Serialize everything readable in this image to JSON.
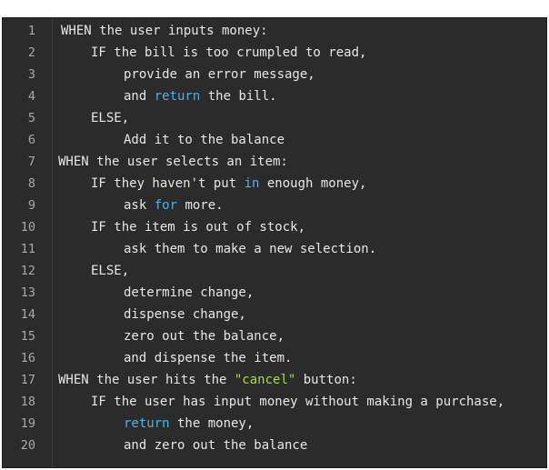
{
  "editor": {
    "lines": [
      {
        "num": "1",
        "indent": 0,
        "segments": [
          {
            "text": "WHEN the user inputs money:",
            "type": "plain"
          }
        ]
      },
      {
        "num": "2",
        "indent": 1,
        "segments": [
          {
            "text": "IF the bill is too crumpled to read,",
            "type": "plain"
          }
        ]
      },
      {
        "num": "3",
        "indent": 2,
        "segments": [
          {
            "text": "provide an error message,",
            "type": "plain"
          }
        ]
      },
      {
        "num": "4",
        "indent": 2,
        "segments": [
          {
            "text": "and ",
            "type": "plain"
          },
          {
            "text": "return",
            "type": "keyword"
          },
          {
            "text": " the bill.",
            "type": "plain"
          }
        ]
      },
      {
        "num": "5",
        "indent": 1,
        "segments": [
          {
            "text": "ELSE,",
            "type": "plain"
          }
        ]
      },
      {
        "num": "6",
        "indent": 2,
        "segments": [
          {
            "text": "Add it to the balance",
            "type": "plain"
          }
        ]
      },
      {
        "num": "7",
        "indent": 0,
        "segments": [
          {
            "text": "WHEN the user selects an item:",
            "type": "plain"
          }
        ]
      },
      {
        "num": "8",
        "indent": 1,
        "segments": [
          {
            "text": "IF they haven't put ",
            "type": "plain"
          },
          {
            "text": "in",
            "type": "keyword"
          },
          {
            "text": " enough money,",
            "type": "plain"
          }
        ]
      },
      {
        "num": "9",
        "indent": 2,
        "segments": [
          {
            "text": "ask ",
            "type": "plain"
          },
          {
            "text": "for",
            "type": "keyword"
          },
          {
            "text": " more.",
            "type": "plain"
          }
        ]
      },
      {
        "num": "10",
        "indent": 1,
        "segments": [
          {
            "text": "IF the item is out of stock,",
            "type": "plain"
          }
        ]
      },
      {
        "num": "11",
        "indent": 2,
        "segments": [
          {
            "text": "ask them to make a new selection.",
            "type": "plain"
          }
        ]
      },
      {
        "num": "12",
        "indent": 1,
        "segments": [
          {
            "text": "ELSE,",
            "type": "plain"
          }
        ]
      },
      {
        "num": "13",
        "indent": 2,
        "segments": [
          {
            "text": "determine change,",
            "type": "plain"
          }
        ]
      },
      {
        "num": "14",
        "indent": 2,
        "segments": [
          {
            "text": "dispense change,",
            "type": "plain"
          }
        ]
      },
      {
        "num": "15",
        "indent": 2,
        "segments": [
          {
            "text": "zero out the balance,",
            "type": "plain"
          }
        ]
      },
      {
        "num": "16",
        "indent": 2,
        "segments": [
          {
            "text": "and dispense the item.",
            "type": "plain"
          }
        ]
      },
      {
        "num": "17",
        "indent": 0,
        "segments": [
          {
            "text": "WHEN the user hits the ",
            "type": "plain"
          },
          {
            "text": "\"cancel\"",
            "type": "string"
          },
          {
            "text": " button:",
            "type": "plain"
          }
        ]
      },
      {
        "num": "18",
        "indent": 1,
        "segments": [
          {
            "text": "IF the user has input money without making a purchase,",
            "type": "plain"
          }
        ]
      },
      {
        "num": "19",
        "indent": 2,
        "segments": [
          {
            "text": "return",
            "type": "keyword"
          },
          {
            "text": " the money,",
            "type": "plain"
          }
        ]
      },
      {
        "num": "20",
        "indent": 2,
        "segments": [
          {
            "text": "and zero out the balance",
            "type": "plain"
          }
        ]
      }
    ]
  },
  "colors": {
    "background": "#2b2b2b",
    "text": "#e6e6e6",
    "line_number": "#a9a9a9",
    "keyword": "#4ab3e8",
    "string": "#a6e22e"
  }
}
